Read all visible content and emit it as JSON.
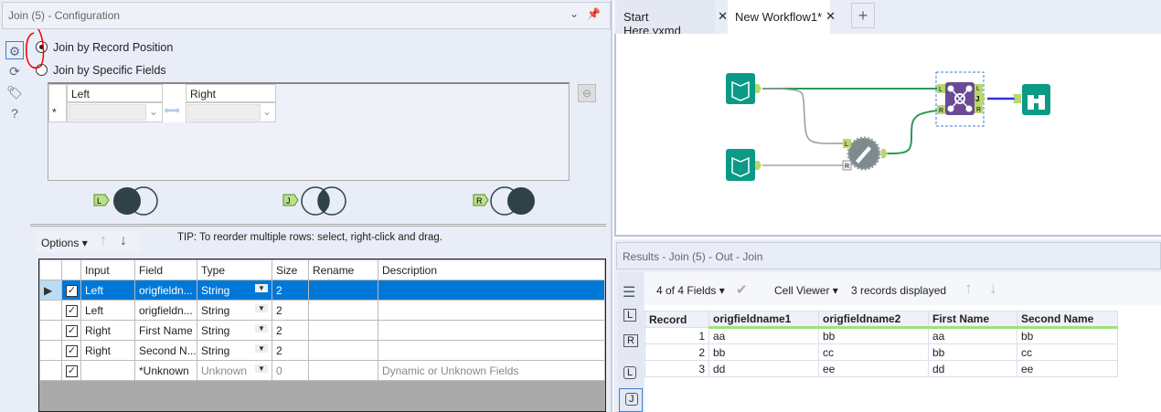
{
  "config": {
    "title": "Join (5) - Configuration",
    "radio_position": "Join by Record Position",
    "radio_fields": "Join by Specific Fields",
    "join_fields": {
      "left_header": "Left",
      "right_header": "Right",
      "row_marker": "*"
    },
    "venn": {
      "left": "L",
      "join": "J",
      "right": "R"
    },
    "options_label": "Options",
    "tip": "TIP: To reorder multiple rows: select, right-click and drag.",
    "columns": [
      "Input",
      "Field",
      "Type",
      "Size",
      "Rename",
      "Description"
    ],
    "rows": [
      {
        "input": "Left",
        "field": "origfieldn...",
        "type": "String",
        "size": "2",
        "rename": "",
        "description": "",
        "selected": true
      },
      {
        "input": "Left",
        "field": "origfieldn...",
        "type": "String",
        "size": "2",
        "rename": "",
        "description": ""
      },
      {
        "input": "Right",
        "field": "First Name",
        "type": "String",
        "size": "2",
        "rename": "",
        "description": ""
      },
      {
        "input": "Right",
        "field": "Second N...",
        "type": "String",
        "size": "2",
        "rename": "",
        "description": ""
      },
      {
        "input": "",
        "field": "*Unknown",
        "type": "Unknown",
        "size": "0",
        "rename": "",
        "description": "Dynamic or Unknown Fields"
      }
    ]
  },
  "tabs": [
    {
      "label": "Start Here.yxmd"
    },
    {
      "label": "New Workflow1*",
      "active": true
    }
  ],
  "canvas": {
    "ports": {
      "L": "L",
      "R": "R",
      "J": "J"
    }
  },
  "results": {
    "title": "Results - Join (5) - Out - Join",
    "fields_label": "4 of 4 Fields",
    "cell_viewer": "Cell Viewer",
    "records_displayed": "3 records displayed",
    "side": {
      "L": "L",
      "R": "R",
      "J": "J"
    },
    "columns": [
      "Record",
      "origfieldname1",
      "origfieldname2",
      "First Name",
      "Second Name"
    ],
    "rows": [
      [
        "1",
        "aa",
        "bb",
        "aa",
        "bb"
      ],
      [
        "2",
        "bb",
        "cc",
        "bb",
        "cc"
      ],
      [
        "3",
        "dd",
        "ee",
        "dd",
        "ee"
      ]
    ]
  },
  "colors": {
    "selection": "#0078d7",
    "tool_teal": "#0a9a85",
    "join_purple": "#6a4a96"
  }
}
